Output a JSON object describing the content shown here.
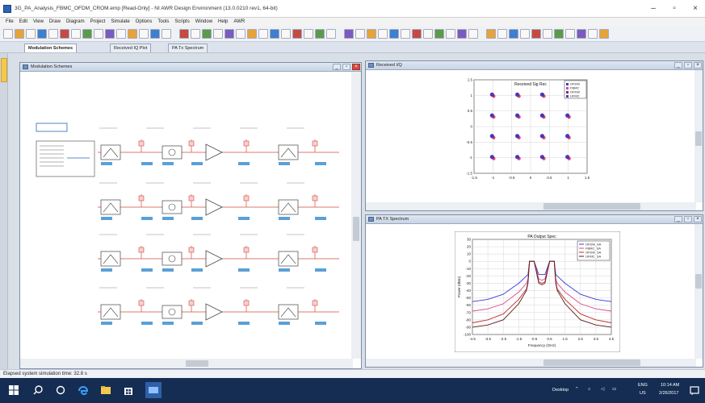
{
  "window_title": "3G_PA_Analysis_FBMC_OFDM_CROM.emp [Read-Only] - NI AWR Design Environment (13.0.0210 rev1, 64-bit)",
  "menu": [
    "File",
    "Edit",
    "View",
    "Draw",
    "Diagram",
    "Project",
    "Simulate",
    "Options",
    "Tools",
    "Scripts",
    "Window",
    "Help",
    "AWR"
  ],
  "tabs": [
    {
      "label": "Modulation Schemes",
      "active": true
    },
    {
      "label": "Received IQ Plot",
      "active": false
    },
    {
      "label": "PA Tx Spectrum",
      "active": false
    }
  ],
  "windows": {
    "schematic": {
      "title": "Modulation Schemes"
    },
    "iq": {
      "title": "Received I/Q"
    },
    "spectrum": {
      "title": "PA TX Spectrum"
    }
  },
  "status_text": "Elapsed system simulation time: 32.8 s",
  "taskbar": {
    "desktop_label": "Desktop",
    "lang": "ENG",
    "region": "US",
    "time": "10:14 AM",
    "date": "2/26/2017"
  },
  "icons": [
    "windows-start-icon",
    "search-icon",
    "task-view-icon",
    "edge-icon",
    "file-explorer-icon",
    "store-icon",
    "awr-app-icon",
    "notification-icon"
  ],
  "colors": {
    "accent": "#2a64b8",
    "taskbar": "#152d52",
    "trace_blue": "#3a3ad8",
    "trace_pink": "#d84a8a",
    "trace_red": "#c22a2a"
  },
  "chart_data": [
    {
      "type": "scatter",
      "title": "Received Sig Rec",
      "xlim": [
        -1.5,
        1.5
      ],
      "ylim": [
        -1.5,
        1.5
      ],
      "xticks": [
        "-1.5",
        "-1",
        "-0.5",
        "0",
        "0.5",
        "1",
        "1.5"
      ],
      "yticks": [
        "1.5",
        "1",
        "0.5",
        "0",
        "-0.5",
        "-1",
        "-1.5"
      ],
      "legend": [
        "OFDM",
        "FBMC",
        "OFDM",
        "UFMC"
      ],
      "legend_position": "top-right",
      "points": [
        {
          "x": -1,
          "y": 1
        },
        {
          "x": -0.33,
          "y": 1
        },
        {
          "x": 0.33,
          "y": 1
        },
        {
          "x": 1,
          "y": 1
        },
        {
          "x": -1,
          "y": 0.33
        },
        {
          "x": -0.33,
          "y": 0.33
        },
        {
          "x": 0.33,
          "y": 0.33
        },
        {
          "x": 1,
          "y": 0.33
        },
        {
          "x": -1,
          "y": -0.33
        },
        {
          "x": -0.33,
          "y": -0.33
        },
        {
          "x": 0.33,
          "y": -0.33
        },
        {
          "x": 1,
          "y": -0.33
        },
        {
          "x": -1,
          "y": -1
        },
        {
          "x": -0.33,
          "y": -1
        },
        {
          "x": 0.33,
          "y": -1
        },
        {
          "x": 1,
          "y": -1
        }
      ]
    },
    {
      "type": "line",
      "title": "PA Output Spec",
      "xlabel": "Frequency (GHz)",
      "ylabel": "Power (dBm)",
      "xlim": [
        -4.5,
        4.5
      ],
      "ylim": [
        -100,
        30
      ],
      "xticks": [
        "-4.5",
        "-3.5",
        "-2.5",
        "-1.5",
        "-0.5",
        "0.5",
        "1.5",
        "2.5",
        "3.5",
        "4.5"
      ],
      "yticks": [
        "30",
        "20",
        "10",
        "0",
        "-10",
        "-20",
        "-30",
        "-40",
        "-50",
        "-60",
        "-70",
        "-80",
        "-90",
        "-100"
      ],
      "legend": [
        "OFDM_SA",
        "FBMC_SA",
        "OFDM_SA",
        "UFMC_SA"
      ],
      "series": [
        {
          "name": "OFDM_SA",
          "x": [
            -4.5,
            -3.5,
            -2.5,
            -1.5,
            -1,
            -0.9,
            -0.8,
            -0.5,
            -0.2,
            0,
            0.2,
            0.5,
            0.8,
            0.9,
            1,
            1.5,
            2.5,
            3.5,
            4.5
          ],
          "y": [
            -55,
            -52,
            -45,
            -30,
            -20,
            -18,
            0,
            0,
            -18,
            -18,
            -18,
            0,
            0,
            -18,
            -20,
            -30,
            -45,
            -52,
            -55
          ]
        },
        {
          "name": "FBMC_SA",
          "x": [
            -4.5,
            -3.5,
            -2.5,
            -1.5,
            -1,
            -0.9,
            -0.8,
            -0.5,
            -0.2,
            0,
            0.2,
            0.5,
            0.8,
            0.9,
            1,
            1.5,
            2.5,
            3.5,
            4.5
          ],
          "y": [
            -68,
            -65,
            -58,
            -42,
            -30,
            -24,
            0,
            0,
            -24,
            -26,
            -24,
            0,
            0,
            -24,
            -30,
            -42,
            -58,
            -65,
            -68
          ]
        },
        {
          "name": "OFDM_SA",
          "x": [
            -4.5,
            -3.5,
            -2.5,
            -1.5,
            -1,
            -0.9,
            -0.8,
            -0.5,
            -0.2,
            0,
            0.2,
            0.5,
            0.8,
            0.9,
            1,
            1.5,
            2.5,
            3.5,
            4.5
          ],
          "y": [
            -84,
            -80,
            -72,
            -52,
            -38,
            -28,
            0,
            0,
            -28,
            -30,
            -28,
            0,
            0,
            -28,
            -38,
            -52,
            -72,
            -80,
            -84
          ]
        },
        {
          "name": "UFMC_SA",
          "x": [
            -4.5,
            -3.5,
            -2.5,
            -1.5,
            -1,
            -0.9,
            -0.8,
            -0.5,
            -0.2,
            0,
            0.2,
            0.5,
            0.8,
            0.9,
            1,
            1.5,
            2.5,
            3.5,
            4.5
          ],
          "y": [
            -90,
            -87,
            -80,
            -58,
            -40,
            -30,
            0,
            0,
            -30,
            -32,
            -30,
            0,
            0,
            -30,
            -40,
            -58,
            -80,
            -87,
            -90
          ]
        }
      ]
    }
  ]
}
